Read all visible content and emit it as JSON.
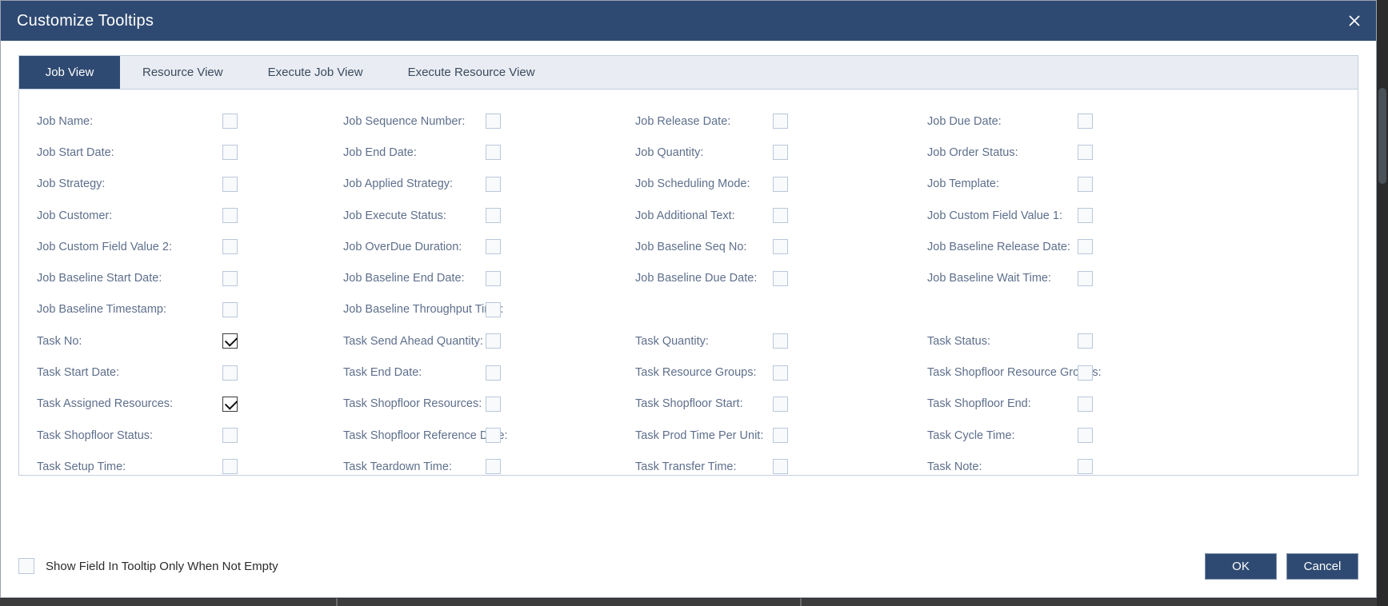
{
  "window": {
    "title": "Customize Tooltips",
    "close_icon": "close-icon",
    "accent_color": "#2f4a72",
    "label_color": "#5e6f8c",
    "border_color": "#c3cedd"
  },
  "tabs": [
    {
      "label": "Job View",
      "active": true
    },
    {
      "label": "Resource View",
      "active": false
    },
    {
      "label": "Execute Job View",
      "active": false
    },
    {
      "label": "Execute Resource View",
      "active": false
    }
  ],
  "fields": [
    [
      {
        "label": "Job Name:",
        "checked": false
      },
      {
        "label": "Job Sequence Number:",
        "checked": false
      },
      {
        "label": "Job Release Date:",
        "checked": false
      },
      {
        "label": "Job Due Date:",
        "checked": false
      }
    ],
    [
      {
        "label": "Job Start Date:",
        "checked": false
      },
      {
        "label": "Job End Date:",
        "checked": false
      },
      {
        "label": "Job Quantity:",
        "checked": false
      },
      {
        "label": "Job Order Status:",
        "checked": false
      }
    ],
    [
      {
        "label": "Job Strategy:",
        "checked": false
      },
      {
        "label": "Job Applied Strategy:",
        "checked": false
      },
      {
        "label": "Job Scheduling Mode:",
        "checked": false
      },
      {
        "label": "Job Template:",
        "checked": false
      }
    ],
    [
      {
        "label": "Job Customer:",
        "checked": false
      },
      {
        "label": "Job Execute Status:",
        "checked": false
      },
      {
        "label": "Job Additional Text:",
        "checked": false
      },
      {
        "label": "Job Custom Field Value 1:",
        "checked": false
      }
    ],
    [
      {
        "label": "Job Custom Field Value 2:",
        "checked": false
      },
      {
        "label": "Job OverDue Duration:",
        "checked": false
      },
      {
        "label": "Job Baseline Seq No:",
        "checked": false
      },
      {
        "label": "Job Baseline Release Date:",
        "checked": false
      }
    ],
    [
      {
        "label": "Job Baseline Start Date:",
        "checked": false
      },
      {
        "label": "Job Baseline End Date:",
        "checked": false
      },
      {
        "label": "Job Baseline Due Date:",
        "checked": false
      },
      {
        "label": "Job Baseline Wait Time:",
        "checked": false
      }
    ],
    [
      {
        "label": "Job Baseline Timestamp:",
        "checked": false
      },
      {
        "label": "Job Baseline Throughput Time:",
        "checked": false
      },
      {
        "label": "",
        "checked": false,
        "empty": true
      },
      {
        "label": "",
        "checked": false,
        "empty": true
      }
    ],
    [
      {
        "label": "Task No:",
        "checked": true
      },
      {
        "label": "Task Send Ahead Quantity:",
        "checked": false
      },
      {
        "label": "Task Quantity:",
        "checked": false
      },
      {
        "label": "Task Status:",
        "checked": false
      }
    ],
    [
      {
        "label": "Task Start Date:",
        "checked": false
      },
      {
        "label": "Task End Date:",
        "checked": false
      },
      {
        "label": "Task Resource Groups:",
        "checked": false
      },
      {
        "label": "Task Shopfloor Resource Groups:",
        "checked": false
      }
    ],
    [
      {
        "label": "Task Assigned Resources:",
        "checked": true
      },
      {
        "label": "Task Shopfloor Resources:",
        "checked": false
      },
      {
        "label": "Task Shopfloor Start:",
        "checked": false
      },
      {
        "label": "Task Shopfloor End:",
        "checked": false
      }
    ],
    [
      {
        "label": "Task Shopfloor Status:",
        "checked": false
      },
      {
        "label": "Task Shopfloor Reference Date:",
        "checked": false
      },
      {
        "label": "Task Prod Time Per Unit:",
        "checked": false
      },
      {
        "label": "Task Cycle Time:",
        "checked": false
      }
    ],
    [
      {
        "label": "Task Setup Time:",
        "checked": false
      },
      {
        "label": "Task Teardown Time:",
        "checked": false
      },
      {
        "label": "Task Transfer Time:",
        "checked": false
      },
      {
        "label": "Task Note:",
        "checked": false
      }
    ]
  ],
  "footer": {
    "show_only_when_not_empty_label": "Show Field In Tooltip Only When Not Empty",
    "show_only_when_not_empty_checked": false,
    "ok_label": "OK",
    "cancel_label": "Cancel"
  }
}
